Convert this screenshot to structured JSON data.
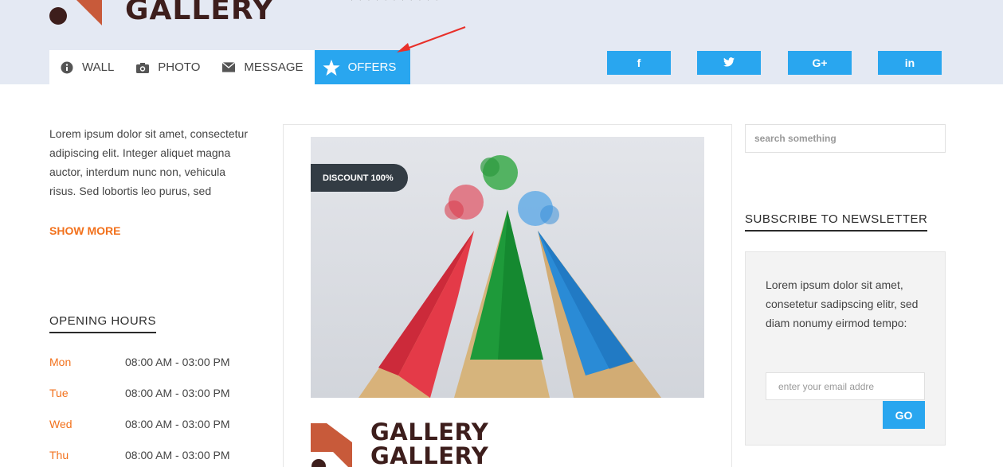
{
  "header": {
    "logo_text": "GALLERY",
    "top_text": ", , , , , , , , , , ,",
    "tabs": [
      {
        "label": "WALL",
        "icon": "info-icon"
      },
      {
        "label": "PHOTO",
        "icon": "camera-icon"
      },
      {
        "label": "MESSAGE",
        "icon": "envelope-icon"
      },
      {
        "label": "OFFERS",
        "icon": "star-icon",
        "active": true
      }
    ],
    "social": [
      {
        "label": "f",
        "icon": "facebook-icon"
      },
      {
        "label": "🐦",
        "icon": "twitter-icon"
      },
      {
        "label": "G+",
        "icon": "google-plus-icon"
      },
      {
        "label": "in",
        "icon": "linkedin-icon"
      }
    ]
  },
  "left": {
    "intro": "Lorem ipsum dolor sit amet, consectetur adipiscing elit. Integer aliquet magna auctor, interdum nunc non, vehicula risus. Sed lobortis leo purus, sed",
    "show_more": "SHOW MORE",
    "hours_title": "OPENING HOURS",
    "hours": [
      {
        "day": "Mon",
        "time": "08:00 AM - 03:00 PM"
      },
      {
        "day": "Tue",
        "time": "08:00 AM - 03:00 PM"
      },
      {
        "day": "Wed",
        "time": "08:00 AM - 03:00 PM"
      },
      {
        "day": "Thu",
        "time": "08:00 AM - 03:00 PM"
      }
    ]
  },
  "center": {
    "badge": "DISCOUNT 100%",
    "logo_text_1": "GALLERY",
    "logo_text_2": "GALLERY"
  },
  "right": {
    "search_placeholder": "search something",
    "newsletter_title": "SUBSCRIBE TO NEWSLETTER",
    "newsletter_text": "Lorem ipsum dolor sit amet, consetetur sadipscing elitr, sed diam nonumy eirmod tempo:",
    "email_placeholder": "enter your email addre",
    "go_label": "GO"
  },
  "colors": {
    "accent": "#29a6ef",
    "orange": "#f2711c",
    "header_bg": "#e4e9f3",
    "badge_bg": "#333c44",
    "logo_brown": "#3d1e1c",
    "logo_orange": "#c85a3a"
  }
}
